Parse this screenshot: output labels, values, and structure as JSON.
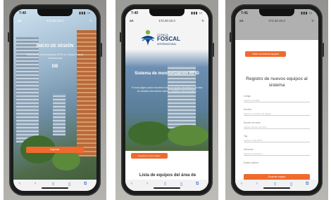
{
  "phone1": {
    "status_time": "7:40",
    "url": "172.20.10.2",
    "title": "INICIO DE SESIÓN",
    "subtitle": "Sistema de monitorización RFID en Clínica Foscal Internacional",
    "db_label": "DB",
    "login_button": "Ingresar"
  },
  "phone2": {
    "status_time": "7:40",
    "url": "172.20.10.2",
    "logo_top": "CLÍNICA",
    "logo_name": "FOSCAL",
    "logo_bottom": "INTERNACIONAL",
    "title": "Sistema de monitorización RFID",
    "body": "En esta página podrá encontrar la lista de equipos biomédicos del área de cuidados intermedios adultos y registrar nuevos equipos.",
    "register_button": "Registrar nuevo equipo",
    "list_heading": "Lista de equipos del área de"
  },
  "phone3": {
    "status_time": "7:41",
    "url": "172.20.10.2",
    "back_button": "Volver a la lista de equipos",
    "title": "Registro de nuevos equipos al sistema",
    "fields": [
      {
        "label": "Código",
        "placeholder": "Ingrese el código"
      },
      {
        "label": "Nombre",
        "placeholder": "Ingrese el nombre del equipo"
      },
      {
        "label": "Número de serie",
        "placeholder": "Ingrese número de serie"
      },
      {
        "label": "Tag",
        "placeholder": "Ingrese el tag RFID"
      },
      {
        "label": "Ubicación",
        "placeholder": "Ingrese la ubicación"
      },
      {
        "label": "Estado (activo)",
        "placeholder": ""
      }
    ],
    "submit_button": "Guardar equipo"
  },
  "colors": {
    "accent_orange": "#ef6a2c",
    "logo_blue": "#1e3d6b",
    "logo_green": "#7cb342"
  }
}
